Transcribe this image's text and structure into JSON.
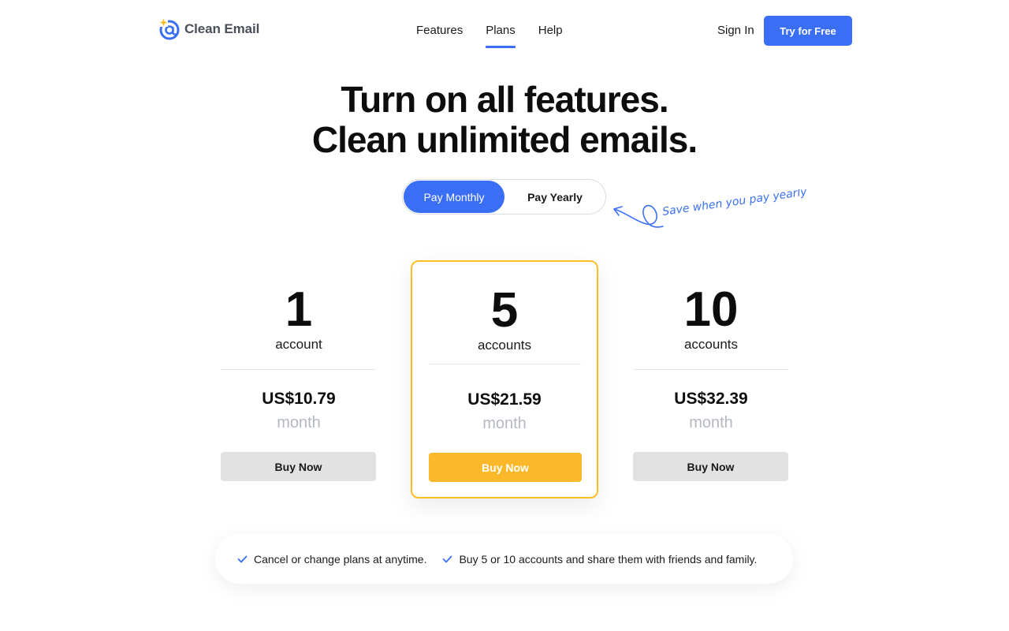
{
  "header": {
    "logo_text": "Clean Email",
    "nav": [
      {
        "label": "Features",
        "active": false
      },
      {
        "label": "Plans",
        "active": true
      },
      {
        "label": "Help",
        "active": false
      }
    ],
    "signin_label": "Sign In",
    "cta_label": "Try for Free"
  },
  "hero": {
    "line1": "Turn on all features.",
    "line2": "Clean unlimited emails."
  },
  "billing_toggle": {
    "monthly_label": "Pay Monthly",
    "yearly_label": "Pay Yearly",
    "selected": "monthly",
    "note": "Save when you pay yearly"
  },
  "plans": [
    {
      "count": "1",
      "unit": "account",
      "price": "US$10.79",
      "period": "month",
      "button": "Buy Now",
      "highlighted": false
    },
    {
      "count": "5",
      "unit": "accounts",
      "price": "US$21.59",
      "period": "month",
      "button": "Buy Now",
      "highlighted": true
    },
    {
      "count": "10",
      "unit": "accounts",
      "price": "US$32.39",
      "period": "month",
      "button": "Buy Now",
      "highlighted": false
    }
  ],
  "benefits": [
    "Cancel or change plans at anytime.",
    "Buy 5 or 10 accounts and share them with friends and family."
  ],
  "colors": {
    "accent": "#3a6ff5",
    "highlight": "#fbbf24",
    "button_gray": "#e2e2e2",
    "muted_text": "#b4b8c0"
  },
  "icons": {
    "logo": "at-sign-sparkle-icon",
    "benefit": "check-icon",
    "note_arrow": "curly-arrow-icon"
  }
}
